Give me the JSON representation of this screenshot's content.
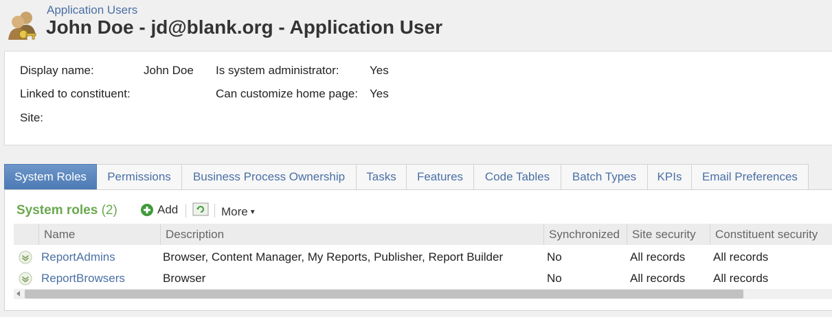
{
  "header": {
    "breadcrumb": "Application Users",
    "title": "John Doe - jd@blank.org - Application User",
    "icon": "users-key-icon"
  },
  "summary": {
    "display_name_label": "Display name:",
    "display_name_value": "John Doe",
    "linked_label": "Linked to constituent:",
    "linked_value": "",
    "site_label": "Site:",
    "site_value": "",
    "sysadmin_label": "Is system administrator:",
    "sysadmin_value": "Yes",
    "customize_label": "Can customize home page:",
    "customize_value": "Yes"
  },
  "tabs": [
    {
      "label": "System Roles",
      "active": true
    },
    {
      "label": "Permissions"
    },
    {
      "label": "Business Process Ownership"
    },
    {
      "label": "Tasks"
    },
    {
      "label": "Features"
    },
    {
      "label": "Code Tables"
    },
    {
      "label": "Batch Types"
    },
    {
      "label": "KPIs"
    },
    {
      "label": "Email Preferences"
    }
  ],
  "section": {
    "title": "System roles",
    "count": "(2)",
    "add_label": "Add",
    "more_label": "More"
  },
  "grid": {
    "columns": [
      "Name",
      "Description",
      "Synchronized",
      "Site security",
      "Constituent security"
    ],
    "rows": [
      {
        "name": "ReportAdmins",
        "description": "Browser, Content Manager, My Reports, Publisher, Report Builder",
        "synchronized": "No",
        "site_security": "All records",
        "constituent_security": "All records"
      },
      {
        "name": "ReportBrowsers",
        "description": "Browser",
        "synchronized": "No",
        "site_security": "All records",
        "constituent_security": "All records"
      }
    ]
  },
  "colors": {
    "accent_blue": "#4a6fa5",
    "active_tab": "#5b86bd",
    "section_green": "#6aa84f"
  }
}
